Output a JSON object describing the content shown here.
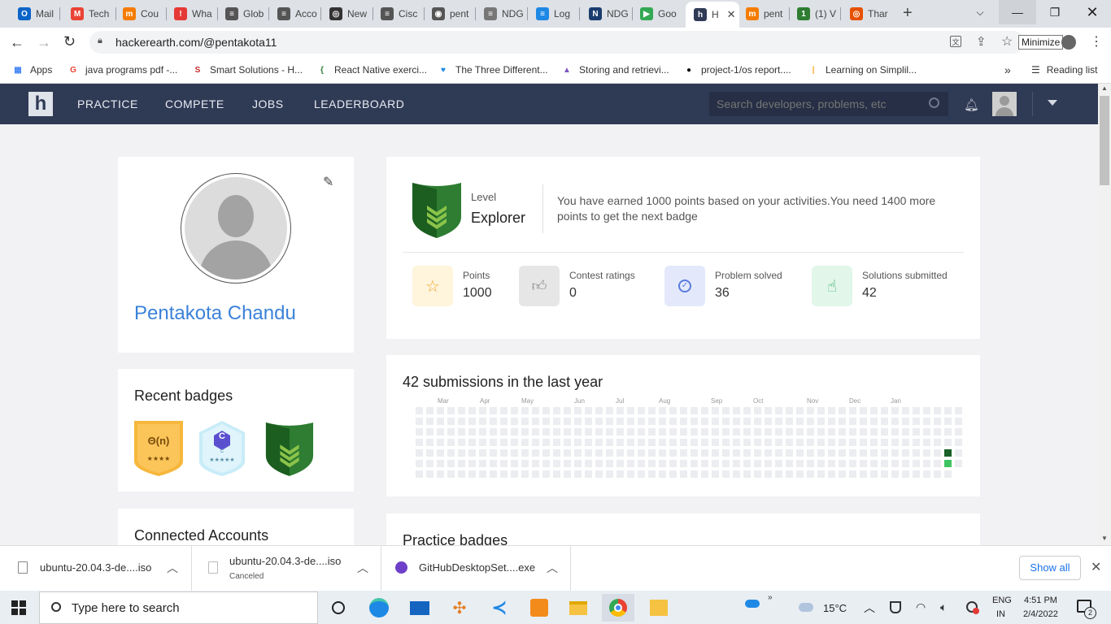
{
  "browser": {
    "tabs": [
      {
        "label": "Mail",
        "color": "#0a64c8",
        "glyph": "O"
      },
      {
        "label": "Tech",
        "color": "#ea4335",
        "glyph": "M"
      },
      {
        "label": "Cou",
        "color": "#f57c00",
        "glyph": "m"
      },
      {
        "label": "Wha",
        "color": "#e53935",
        "glyph": "!"
      },
      {
        "label": "Glob",
        "color": "#555555",
        "glyph": "≡"
      },
      {
        "label": "Acco",
        "color": "#555555",
        "glyph": "≡"
      },
      {
        "label": "New",
        "color": "#333333",
        "glyph": "◎"
      },
      {
        "label": "Cisc",
        "color": "#555555",
        "glyph": "≡"
      },
      {
        "label": "pent",
        "color": "#555555",
        "glyph": "◉"
      },
      {
        "label": "NDG",
        "color": "#777777",
        "glyph": "≡"
      },
      {
        "label": "Log",
        "color": "#1e88e5",
        "glyph": "≡"
      },
      {
        "label": "NDG",
        "color": "#1a3c6e",
        "glyph": "N"
      },
      {
        "label": "Goo",
        "color": "#34a853",
        "glyph": "▶"
      },
      {
        "label": "H",
        "color": "#2f3a55",
        "glyph": "h"
      },
      {
        "label": "pent",
        "color": "#f57c00",
        "glyph": "m"
      },
      {
        "label": "(1) V",
        "color": "#2e7d32",
        "glyph": "1"
      },
      {
        "label": "Thar",
        "color": "#e65100",
        "glyph": "◎"
      }
    ],
    "new_tab": "+",
    "url": "hackerearth.com/@pentakota11",
    "tooltip": "Minimize",
    "bookmarks": [
      {
        "label": "Apps",
        "color": "#4285f4",
        "glyph": "▦"
      },
      {
        "label": "java programs pdf -...",
        "color": "#ea4335",
        "glyph": "G"
      },
      {
        "label": "Smart Solutions - H...",
        "color": "#c62828",
        "glyph": "S"
      },
      {
        "label": "React Native exerci...",
        "color": "#2e7d32",
        "glyph": "{"
      },
      {
        "label": "The Three Different...",
        "color": "#1e88e5",
        "glyph": "♥"
      },
      {
        "label": "Storing and retrievi...",
        "color": "#7e57c2",
        "glyph": "▲"
      },
      {
        "label": "project-1/os report....",
        "color": "#111111",
        "glyph": "●"
      },
      {
        "label": "Learning on Simplil...",
        "color": "#f9a825",
        "glyph": "|"
      }
    ],
    "more": "»",
    "reading_list": "Reading list"
  },
  "site": {
    "logo": "h",
    "nav": [
      "PRACTICE",
      "COMPETE",
      "JOBS",
      "LEADERBOARD"
    ],
    "search_placeholder": "Search developers, problems, etc"
  },
  "profile": {
    "name": "Pentakota Chandu",
    "level_label": "Level",
    "level": "Explorer",
    "level_message": "You have earned 1000 points based on your activities.You need 1400 more points to get the next badge",
    "stats": [
      {
        "label": "Points",
        "value": "1000",
        "bg": "#fff4dc",
        "icon_color": "#f0a830",
        "icon": "star-icon"
      },
      {
        "label": "Contest ratings",
        "value": "0",
        "bg": "#e6e6e6",
        "icon_color": "#888888",
        "icon": "thumbs-up-icon"
      },
      {
        "label": "Problem solved",
        "value": "36",
        "bg": "#e3e9fb",
        "icon_color": "#5b7be0",
        "icon": "check-circle-icon"
      },
      {
        "label": "Solutions submitted",
        "value": "42",
        "bg": "#e2f6ea",
        "icon_color": "#3cb371",
        "icon": "hand-pointer-icon"
      }
    ]
  },
  "recent_badges": {
    "title": "Recent badges",
    "items": [
      {
        "text": "Θ(n)",
        "stars": "★★★★"
      },
      {
        "text": "C",
        "sub": "C",
        "stars": "★★★★★"
      },
      {
        "text": ""
      }
    ]
  },
  "connected": {
    "title": "Connected Accounts"
  },
  "submissions": {
    "title": "42 submissions in the last year",
    "months": [
      "Mar",
      "Apr",
      "May",
      "Jun",
      "Jul",
      "Aug",
      "Sep",
      "Oct",
      "Nov",
      "Dec",
      "Jan"
    ],
    "active_cells": [
      {
        "week": 50,
        "day": 4,
        "level": "dark"
      },
      {
        "week": 50,
        "day": 5,
        "level": "light"
      }
    ],
    "colors": {
      "empty": "#ebedf0",
      "dark": "#196127",
      "light": "#40c463"
    }
  },
  "practice_badges": {
    "title": "Practice badges"
  },
  "downloads": [
    {
      "name": "ubuntu-20.04.3-de....iso",
      "status": ""
    },
    {
      "name": "ubuntu-20.04.3-de....iso",
      "status": "Canceled"
    },
    {
      "name": "GitHubDesktopSet....exe",
      "status": ""
    }
  ],
  "downloads_show_all": "Show all",
  "taskbar": {
    "search_placeholder": "Type here to search",
    "weather": "15°C",
    "lang": "ENG",
    "region": "IN",
    "time": "4:51 PM",
    "date": "2/4/2022",
    "notifications": "2"
  }
}
